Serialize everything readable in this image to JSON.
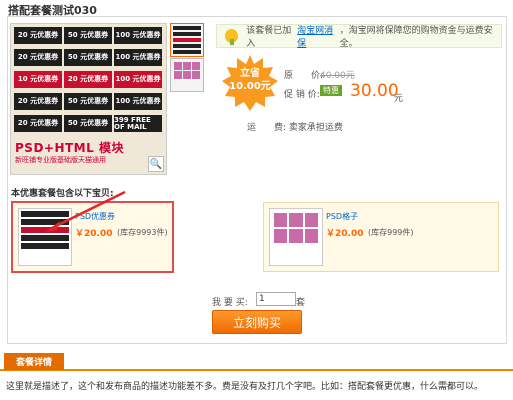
{
  "page_title": "搭配套餐测试030",
  "main_image": {
    "coupon_rows": [
      [
        {
          "amount": "20",
          "label": "元优惠券",
          "red": false
        },
        {
          "amount": "50",
          "label": "元优惠券",
          "red": false
        },
        {
          "amount": "100",
          "label": "元优惠券",
          "red": false
        }
      ],
      [
        {
          "amount": "20",
          "label": "元优惠券",
          "red": false
        },
        {
          "amount": "50",
          "label": "元优惠券",
          "red": false
        },
        {
          "amount": "100",
          "label": "元优惠券",
          "red": false
        }
      ],
      [
        {
          "amount": "10",
          "label": "元优惠券",
          "red": true
        },
        {
          "amount": "20",
          "label": "元优惠券",
          "red": true
        },
        {
          "amount": "100",
          "label": "元优惠券",
          "red": true
        }
      ],
      [
        {
          "amount": "20",
          "label": "元优惠券",
          "red": false
        },
        {
          "amount": "50",
          "label": "元优惠券",
          "red": false
        },
        {
          "amount": "100",
          "label": "元优惠券",
          "red": false
        }
      ],
      [
        {
          "amount": "20",
          "label": "元优惠券",
          "red": false
        },
        {
          "amount": "50",
          "label": "元优惠券",
          "red": false
        },
        {
          "amount": "399",
          "label": "FREE OF MAIL",
          "red": false
        }
      ]
    ],
    "banner_text": "PSD+HTML 模块",
    "banner_sub": "新旺铺专业版基础版天猫通用"
  },
  "notice": {
    "prefix": "该套餐已加入",
    "link": "淘宝网消保",
    "suffix": "，淘宝网将保障您的购物资金与运费安全。"
  },
  "price_badge": {
    "line1": "立省",
    "line2": "10.00元"
  },
  "original_price": {
    "label": "原　　价:",
    "value": "40.00元"
  },
  "promo_price": {
    "label": "促 销 价:",
    "tag": "特惠",
    "value": "30.00",
    "unit": "元"
  },
  "shipping": {
    "label": "运　　费:",
    "value": "卖家承担运费"
  },
  "section_label": "本优惠套餐包含以下宝贝:",
  "products": [
    {
      "name": "PSD优惠券",
      "price": "￥20.00",
      "stock": "(库存9993件)"
    },
    {
      "name": "PSD格子",
      "price": "￥20.00",
      "stock": "(库存999件)"
    }
  ],
  "quantity": {
    "label": "我 要 买:",
    "value": "1",
    "unit": "套"
  },
  "buy_button": "立刻购买",
  "tab_label": "套餐详情",
  "description": "这里就是描述了，这个和发布商品的描述功能差不多。费是没有及打几个字吧。比如：搭配套餐更优惠，什么需都可以。",
  "colors": {
    "accent": "#f06a00",
    "price": "#ff6600",
    "link": "#0066cc",
    "tag_green": "#6aa329"
  }
}
